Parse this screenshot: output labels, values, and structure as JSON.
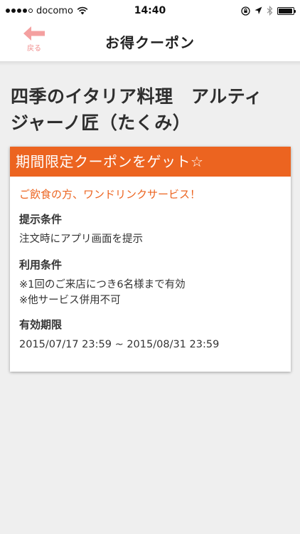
{
  "status_bar": {
    "carrier": "docomo",
    "time": "14:40"
  },
  "nav": {
    "title": "お得クーポン",
    "back_label": "戻る"
  },
  "store": {
    "name_line1": "四季のイタリア料理　アルティ",
    "name_line2": "ジャーノ匠（たくみ）"
  },
  "coupon": {
    "header": "期間限定クーポンをゲット☆",
    "offer": "ご飲食の方、ワンドリンクサービス！",
    "presentation_heading": "提示条件",
    "presentation_text": "注文時にアプリ画面を提示",
    "terms_heading": "利用条件",
    "terms_line1": "※1回のご来店につき6名様まで有効",
    "terms_line2": "※他サービス併用不可",
    "validity_heading": "有効期限",
    "validity_text": "2015/07/17 23:59 ~ 2015/08/31 23:59"
  },
  "colors": {
    "accent": "#ec6420",
    "back_arrow": "#f4a0a0"
  }
}
